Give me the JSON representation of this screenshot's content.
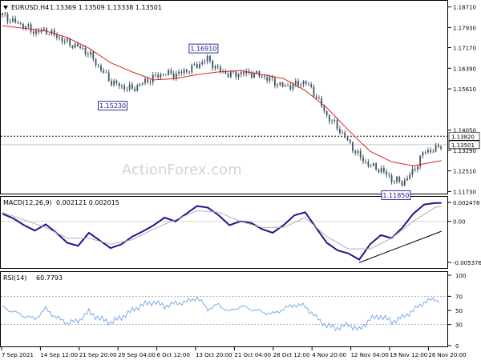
{
  "chart_data": [
    {
      "panel": "price",
      "type": "candlestick",
      "header": {
        "symbol": "EURUSD,H4",
        "ohlc": "1.13369 1.13509 1.13338 1.13501"
      },
      "watermark": "ActionForex.com",
      "ylim": [
        1.1165,
        1.1885
      ],
      "yticks": [
        "1.18710",
        "1.17930",
        "1.17170",
        "1.16390",
        "1.15610",
        "1.14050",
        "1.13290",
        "1.12510",
        "1.11730"
      ],
      "current_price_label": "1.13501",
      "reference_line": {
        "value": 1.1382,
        "label": "1.13820",
        "style": "dotted"
      },
      "annotations": [
        {
          "text": "1.16910",
          "date_index": 9.3,
          "value": 1.1691,
          "placement": "above"
        },
        {
          "text": "1.15230",
          "date_index": 5.1,
          "value": 1.1523,
          "placement": "below"
        },
        {
          "text": "1.11850",
          "date_index": 18.2,
          "value": 1.1185,
          "placement": "below"
        }
      ],
      "close_path": [
        [
          0,
          1.184
        ],
        [
          0.5,
          1.1815
        ],
        [
          1,
          1.18
        ],
        [
          1.5,
          1.1775
        ],
        [
          2,
          1.1782
        ],
        [
          2.5,
          1.176
        ],
        [
          3,
          1.1735
        ],
        [
          3.5,
          1.172
        ],
        [
          4,
          1.1695
        ],
        [
          4.5,
          1.164
        ],
        [
          5,
          1.159
        ],
        [
          5.5,
          1.157
        ],
        [
          6,
          1.156
        ],
        [
          6.5,
          1.1585
        ],
        [
          7,
          1.1605
        ],
        [
          7.5,
          1.162
        ],
        [
          8,
          1.1615
        ],
        [
          8.5,
          1.163
        ],
        [
          9,
          1.165
        ],
        [
          9.5,
          1.1675
        ],
        [
          10,
          1.163
        ],
        [
          10.5,
          1.1615
        ],
        [
          11,
          1.162
        ],
        [
          11.5,
          1.162
        ],
        [
          12,
          1.161
        ],
        [
          12.5,
          1.159
        ],
        [
          13,
          1.157
        ],
        [
          13.5,
          1.1575
        ],
        [
          14,
          1.159
        ],
        [
          14.5,
          1.1535
        ],
        [
          15,
          1.146
        ],
        [
          15.5,
          1.1415
        ],
        [
          16,
          1.136
        ],
        [
          16.5,
          1.1305
        ],
        [
          17,
          1.127
        ],
        [
          17.5,
          1.1255
        ],
        [
          18,
          1.122
        ],
        [
          18.5,
          1.1205
        ],
        [
          19,
          1.125
        ],
        [
          19.5,
          1.1325
        ],
        [
          20,
          1.133
        ],
        [
          20.3,
          1.135
        ]
      ],
      "sma_path": [
        [
          0,
          1.18
        ],
        [
          1,
          1.179
        ],
        [
          2,
          1.178
        ],
        [
          3,
          1.1755
        ],
        [
          4,
          1.1715
        ],
        [
          5,
          1.166
        ],
        [
          6,
          1.1625
        ],
        [
          7,
          1.1595
        ],
        [
          8,
          1.16
        ],
        [
          9,
          1.1615
        ],
        [
          10,
          1.1625
        ],
        [
          11,
          1.163
        ],
        [
          12,
          1.1615
        ],
        [
          13,
          1.16
        ],
        [
          14,
          1.1555
        ],
        [
          15,
          1.149
        ],
        [
          16,
          1.1405
        ],
        [
          17,
          1.1325
        ],
        [
          18,
          1.1285
        ],
        [
          19,
          1.127
        ],
        [
          20,
          1.1285
        ],
        [
          20.3,
          1.129
        ]
      ]
    },
    {
      "panel": "macd",
      "type": "line",
      "header": {
        "name": "MACD(12,26,9)",
        "values": "0.002121 0.002015"
      },
      "ylim": [
        -0.006,
        0.0028
      ],
      "yticks": [
        "0.002478",
        "0.00",
        "-0.005376"
      ],
      "zero_line": 0,
      "series": [
        {
          "name": "MACD",
          "role": "main",
          "color": "#1a1a8c",
          "points": [
            [
              0,
              0.001
            ],
            [
              0.5,
              0.0004
            ],
            [
              1,
              -0.0005
            ],
            [
              1.5,
              -0.0012
            ],
            [
              2,
              -0.0004
            ],
            [
              2.5,
              -0.0015
            ],
            [
              3,
              -0.0028
            ],
            [
              3.5,
              -0.0032
            ],
            [
              4,
              -0.0015
            ],
            [
              4.5,
              -0.0025
            ],
            [
              5,
              -0.0035
            ],
            [
              5.5,
              -0.003
            ],
            [
              6,
              -0.002
            ],
            [
              6.5,
              -0.0013
            ],
            [
              7,
              -0.0005
            ],
            [
              7.5,
              0.0005
            ],
            [
              8,
              0.0
            ],
            [
              8.5,
              0.001
            ],
            [
              9,
              0.002
            ],
            [
              9.5,
              0.0018
            ],
            [
              10,
              0.0008
            ],
            [
              10.5,
              -0.0005
            ],
            [
              11,
              0.0
            ],
            [
              11.5,
              -0.0002
            ],
            [
              12,
              -0.001
            ],
            [
              12.5,
              -0.0015
            ],
            [
              13,
              -0.0005
            ],
            [
              13.5,
              0.0008
            ],
            [
              14,
              0.0012
            ],
            [
              14.5,
              -0.0008
            ],
            [
              15,
              -0.0028
            ],
            [
              15.5,
              -0.0038
            ],
            [
              16,
              -0.0042
            ],
            [
              16.5,
              -0.005
            ],
            [
              17,
              -0.003
            ],
            [
              17.5,
              -0.0018
            ],
            [
              18,
              -0.0022
            ],
            [
              18.5,
              -0.0008
            ],
            [
              19,
              0.001
            ],
            [
              19.5,
              0.0022
            ],
            [
              20,
              0.0024
            ],
            [
              20.3,
              0.0024
            ]
          ]
        },
        {
          "name": "Signal",
          "role": "signal",
          "color": "#b0b0b0",
          "points": [
            [
              0,
              0.0012
            ],
            [
              1,
              0.0002
            ],
            [
              2,
              -0.0008
            ],
            [
              3,
              -0.0022
            ],
            [
              4,
              -0.0022
            ],
            [
              5,
              -0.003
            ],
            [
              6,
              -0.0024
            ],
            [
              7,
              -0.001
            ],
            [
              8,
              0.0002
            ],
            [
              9,
              0.0014
            ],
            [
              10,
              0.0012
            ],
            [
              11,
              0.0
            ],
            [
              12,
              -0.0008
            ],
            [
              13,
              -0.0008
            ],
            [
              14,
              0.0005
            ],
            [
              15,
              -0.002
            ],
            [
              16,
              -0.0036
            ],
            [
              17,
              -0.0036
            ],
            [
              18,
              -0.0022
            ],
            [
              19,
              0.0
            ],
            [
              20,
              0.0018
            ],
            [
              20.3,
              0.002
            ]
          ]
        }
      ],
      "trendline": [
        [
          16.5,
          -0.0054
        ],
        [
          20.3,
          -0.0013
        ]
      ]
    },
    {
      "panel": "rsi",
      "type": "line",
      "header": {
        "name": "RSI(14)",
        "value": "60.7793"
      },
      "ylim": [
        0,
        100
      ],
      "yticks": [
        "100",
        "70",
        "50",
        "30",
        "0"
      ],
      "levels": [
        70,
        30
      ],
      "series": [
        {
          "name": "RSI",
          "color": "#6aa6e6",
          "points": [
            [
              0,
              55
            ],
            [
              0.5,
              48
            ],
            [
              1,
              42
            ],
            [
              1.5,
              38
            ],
            [
              2,
              52
            ],
            [
              2.5,
              40
            ],
            [
              3,
              32
            ],
            [
              3.5,
              35
            ],
            [
              4,
              48
            ],
            [
              4.5,
              38
            ],
            [
              5,
              33
            ],
            [
              5.5,
              40
            ],
            [
              6,
              50
            ],
            [
              6.5,
              58
            ],
            [
              7,
              62
            ],
            [
              7.5,
              56
            ],
            [
              8,
              60
            ],
            [
              8.5,
              62
            ],
            [
              9,
              68
            ],
            [
              9.5,
              52
            ],
            [
              10,
              58
            ],
            [
              10.5,
              48
            ],
            [
              11,
              56
            ],
            [
              11.5,
              52
            ],
            [
              12,
              48
            ],
            [
              12.5,
              45
            ],
            [
              13,
              52
            ],
            [
              13.5,
              58
            ],
            [
              14,
              56
            ],
            [
              14.5,
              40
            ],
            [
              15,
              28
            ],
            [
              15.5,
              25
            ],
            [
              16,
              30
            ],
            [
              16.5,
              22
            ],
            [
              17,
              38
            ],
            [
              17.5,
              42
            ],
            [
              18,
              34
            ],
            [
              18.5,
              40
            ],
            [
              19,
              50
            ],
            [
              19.5,
              62
            ],
            [
              20,
              66
            ],
            [
              20.3,
              62
            ]
          ]
        }
      ]
    },
    {
      "panel": "time-axis",
      "type": "axis",
      "x_labels": [
        "7 Sep 2021",
        "14 Sep 12:00",
        "21 Sep 20:00",
        "29 Sep 04:00",
        "6 Oct 12:00",
        "13 Oct 20:00",
        "21 Oct 04:00",
        "28 Oct 12:00",
        "4 Nov 20:00",
        "12 Nov 04:00",
        "19 Nov 12:00",
        "26 Nov 20:00"
      ]
    }
  ]
}
